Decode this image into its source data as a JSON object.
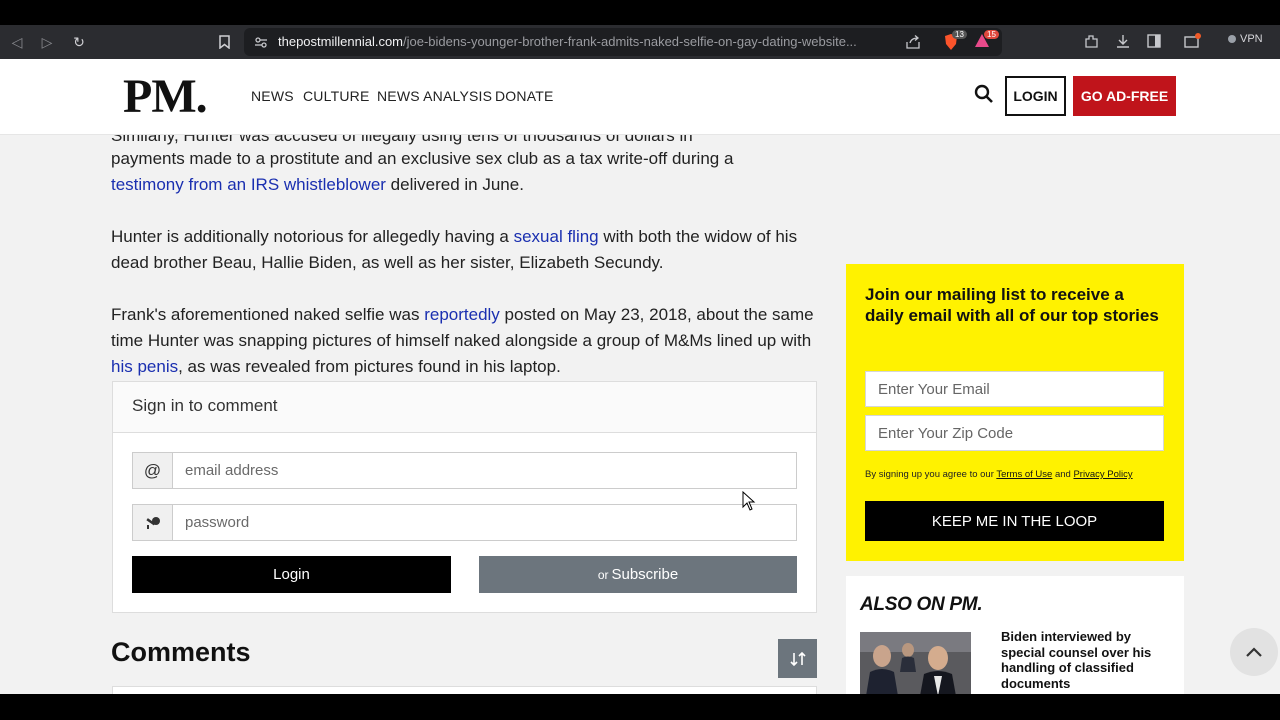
{
  "browser": {
    "url_host": "thepostmillennial.com",
    "url_path": "/joe-bidens-younger-brother-frank-admits-naked-selfie-on-gay-dating-website...",
    "shield_badge": "13",
    "rewards_badge": "15",
    "vpn_label": "VPN"
  },
  "header": {
    "logo": "PM.",
    "nav": [
      "NEWS",
      "CULTURE",
      "NEWS ANALYSIS",
      "DONATE"
    ],
    "login_label": "LOGIN",
    "adfree_label": "GO AD-FREE"
  },
  "article": {
    "p0_line": "Similarly, Hunter was accused of illegally using tens of thousands of dollars in",
    "p1_text_a": "payments made to a prostitute and an exclusive sex club as a tax write-off during a",
    "p1_link": "testimony from an IRS whistleblower",
    "p1_text_b": " delivered in June.",
    "p2_text_a": "Hunter is additionally notorious for allegedly having a ",
    "p2_link": "sexual fling",
    "p2_text_b": " with both the widow of his dead brother Beau, Hallie Biden, as well as her sister, Elizabeth Secundy.",
    "p3_text_a": "Frank's aforementioned naked selfie was ",
    "p3_link1": "reportedly",
    "p3_text_b": " posted on May 23, 2018, about the same time Hunter was snapping pictures of himself naked alongside a group of M&Ms lined up with ",
    "p3_link2": "his penis",
    "p3_text_c": ", as was revealed from pictures found in his laptop."
  },
  "comment_form": {
    "heading": "Sign in to comment",
    "email_addon": "@",
    "email_placeholder": "email address",
    "password_placeholder": "password",
    "login_label": "Login",
    "subscribe_or": "or",
    "subscribe_label": "Subscribe"
  },
  "comments": {
    "title": "Comments",
    "sort_icon": "sort-arrows-icon"
  },
  "mailing": {
    "title": "Join our mailing list to receive a daily email with all of our top stories",
    "email_placeholder": "Enter Your Email",
    "zip_placeholder": "Enter Your Zip Code",
    "terms_prefix": "By signing up you agree to our ",
    "terms_link": "Terms of Use",
    "terms_and": " and ",
    "privacy_link": "Privacy Policy",
    "button_label": "KEEP ME IN THE LOOP"
  },
  "also_on": {
    "title": "ALSO ON PM.",
    "headline": "Biden interviewed by special counsel over his handling of classified documents"
  },
  "colors": {
    "brand_red": "#c0141b",
    "mailing_yellow": "#fff200",
    "link_blue": "#1a2fb0"
  }
}
